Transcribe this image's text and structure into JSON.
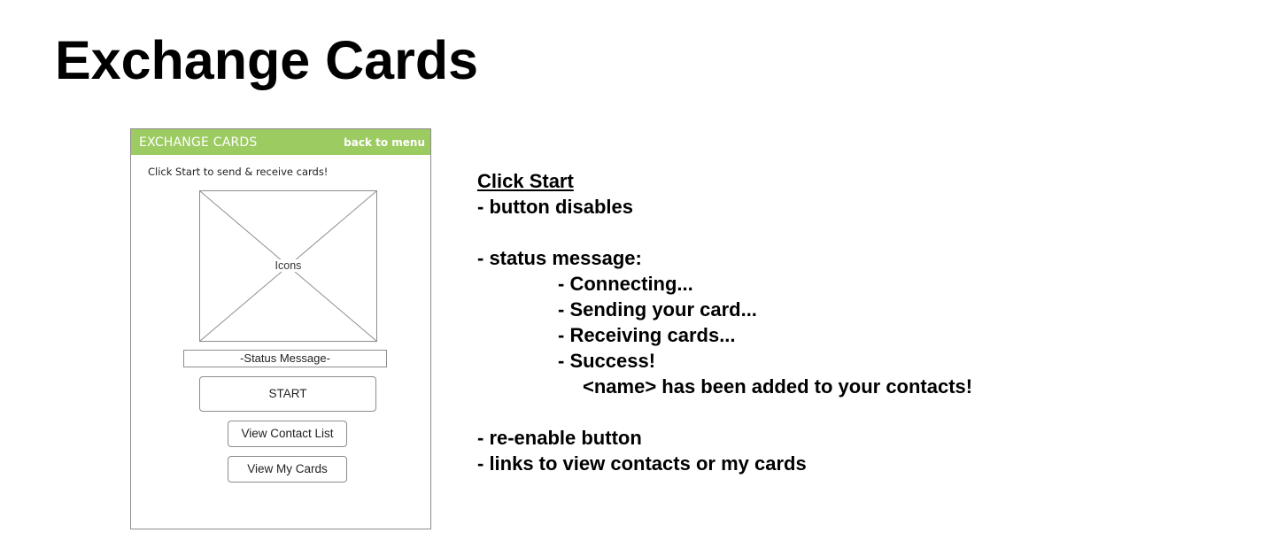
{
  "page": {
    "title": "Exchange Cards"
  },
  "app": {
    "header": {
      "title": "EXCHANGE CARDS",
      "back_link": "back to menu",
      "background_color": "#9ccb62"
    },
    "instruction": "Click Start to send & receive cards!",
    "icons_placeholder_label": "Icons",
    "status_message": "-Status Message-",
    "start_button": "START",
    "view_contact_list_button": "View Contact List",
    "view_my_cards_button": "View My Cards"
  },
  "notes": {
    "heading": "Click Start",
    "button_disables": "- button disables",
    "status_intro": "- status message:",
    "statuses": [
      "- Connecting...",
      "- Sending your card...",
      "- Receiving cards...",
      "- Success!"
    ],
    "success_detail": "<name> has been added to your contacts!",
    "reenable": "- re-enable button",
    "links": "- links to view contacts or my cards"
  }
}
